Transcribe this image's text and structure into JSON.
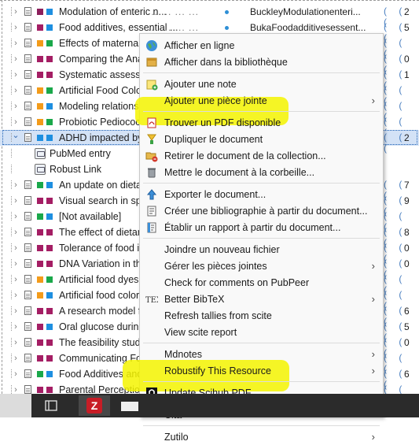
{
  "items": [
    {
      "title": "Modulation of enteric n...",
      "rest": "... ... ... ...",
      "file": "BuckleyModulationenteri...",
      "num": "2",
      "c1": "#8c1f5c",
      "c2": "#1e8fe0"
    },
    {
      "title": "Food additives, essential ...",
      "rest": "... ... ... ...",
      "file": "BukaFoodadditivesessent...",
      "num": "5",
      "c1": "#a41e64",
      "c2": "#1e8fe0"
    },
    {
      "title": "Effects of maternally ...",
      "rest": "",
      "file": "",
      "num": "",
      "c1": "#f39b1a",
      "c2": "#1aa84a"
    },
    {
      "title": "Comparing the Analge...",
      "rest": "",
      "file": "",
      "num": "0",
      "c1": "#a41e64",
      "c2": "#a41e64"
    },
    {
      "title": "Systematic assessmen...",
      "rest": "",
      "file": "",
      "num": "1",
      "c1": "#a41e64",
      "c2": "#a41e64"
    },
    {
      "title": "Artificial Food Color...",
      "rest": "",
      "file": "",
      "num": "",
      "c1": "#f39b1a",
      "c2": "#1aa84a"
    },
    {
      "title": "Modeling relations ...",
      "rest": "",
      "file": "",
      "num": "",
      "c1": "#f39b1a",
      "c2": "#1e8fe0"
    },
    {
      "title": "Probiotic Pediococc...",
      "rest": "",
      "file": "",
      "num": "",
      "c1": "#f39b1a",
      "c2": "#1aa84a"
    },
    {
      "title": "ADHD impacted by su...",
      "rest": "",
      "file": "",
      "num": "2",
      "c1": "#1e8fe0",
      "c2": "#1e8fe0",
      "selected": true,
      "expanded": true
    },
    {
      "child": true,
      "title": "PubMed entry"
    },
    {
      "child": true,
      "title": "Robust Link"
    },
    {
      "title": "An update on dieta...",
      "rest": "",
      "file": "",
      "num": "7",
      "c1": "#1aa84a",
      "c2": "#1e8fe0"
    },
    {
      "title": "Visual search in spatia...",
      "rest": "",
      "file": "",
      "num": "9",
      "c1": "#a41e64",
      "c2": "#a41e64"
    },
    {
      "title": "[Not available]",
      "rest": "",
      "file": "",
      "num": "",
      "c1": "#1aa84a",
      "c2": "#1e8fe0"
    },
    {
      "title": "The effect of dietary e...",
      "rest": "",
      "file": "",
      "num": "8",
      "c1": "#a41e64",
      "c2": "#a41e64"
    },
    {
      "title": "Tolerance of food into...",
      "rest": "",
      "file": "",
      "num": "0",
      "c1": "#a41e64",
      "c2": "#a41e64"
    },
    {
      "title": "DNA Variation in the S...",
      "rest": "",
      "file": "",
      "num": "0",
      "c1": "#a41e64",
      "c2": "#a41e64"
    },
    {
      "title": "Artificial food dyes ...",
      "rest": "",
      "file": "",
      "num": "",
      "c1": "#f39b1a",
      "c2": "#1aa84a"
    },
    {
      "title": "Artificial food colori...",
      "rest": "",
      "file": "",
      "num": "",
      "c1": "#f39b1a",
      "c2": "#1e8fe0"
    },
    {
      "title": "A research model for ...",
      "rest": "",
      "file": "",
      "num": "6",
      "c1": "#a41e64",
      "c2": "#a41e64"
    },
    {
      "title": "Oral glucose during ...",
      "rest": "",
      "file": "",
      "num": "5",
      "c1": "#a41e64",
      "c2": "#1e8fe0"
    },
    {
      "title": "The feasibility study o...",
      "rest": "",
      "file": "",
      "num": "0",
      "c1": "#a41e64",
      "c2": "#a41e64"
    },
    {
      "title": "Communicating Food...",
      "rest": "",
      "file": "",
      "num": "",
      "c1": "#a41e64",
      "c2": "#a41e64"
    },
    {
      "title": "Food Additives and ...",
      "rest": "",
      "file": "",
      "num": "6",
      "c1": "#1aa84a",
      "c2": "#1e8fe0"
    },
    {
      "title": "Parental Perception...",
      "rest": "",
      "file": "",
      "num": "",
      "c1": "#a41e64",
      "c2": "#a41e64"
    }
  ],
  "menu": {
    "groups": [
      [
        {
          "label": "Afficher en ligne",
          "icon": "globe-icon"
        },
        {
          "label": "Afficher dans la bibliothèque",
          "icon": "library-icon"
        }
      ],
      [
        {
          "label": "Ajouter une note",
          "icon": "note-icon"
        },
        {
          "label": "Ajouter une pièce jointe",
          "icon": "",
          "submenu": true
        }
      ],
      [
        {
          "label": "Trouver un PDF disponible",
          "icon": "pdf-icon"
        },
        {
          "label": "Dupliquer le document",
          "icon": "duplicate-icon"
        },
        {
          "label": "Retirer le document de la collection...",
          "icon": "remove-folder-icon"
        },
        {
          "label": "Mettre le document à la corbeille...",
          "icon": "trash-icon"
        }
      ],
      [
        {
          "label": "Exporter le document...",
          "icon": "export-icon"
        },
        {
          "label": "Créer une bibliographie à partir du document...",
          "icon": "bibliography-icon"
        },
        {
          "label": "Établir un rapport à partir du document...",
          "icon": "report-icon"
        }
      ],
      [
        {
          "label": "Joindre un nouveau fichier",
          "icon": ""
        },
        {
          "label": "Gérer les pièces jointes",
          "icon": "",
          "submenu": true
        },
        {
          "label": "Check for comments on PubPeer",
          "icon": ""
        },
        {
          "label": "Better BibTeX",
          "icon": "tex-icon",
          "submenu": true
        },
        {
          "label": "Refresh tallies from scite",
          "icon": ""
        },
        {
          "label": "View scite report",
          "icon": ""
        }
      ],
      [
        {
          "label": "Mdnotes",
          "icon": "",
          "submenu": true
        },
        {
          "label": "Robustify This Resource",
          "icon": "",
          "submenu": true
        }
      ],
      [
        {
          "label": "Update Scihub PDF",
          "icon": "scihub-icon"
        }
      ],
      [
        {
          "label": "Cita",
          "icon": "",
          "submenu": true
        }
      ],
      [
        {
          "label": "Zutilo",
          "icon": "",
          "submenu": true
        }
      ]
    ]
  },
  "taskbar": {
    "apps": [
      "sidebar-app",
      "zotero-app",
      "partial-app"
    ]
  }
}
